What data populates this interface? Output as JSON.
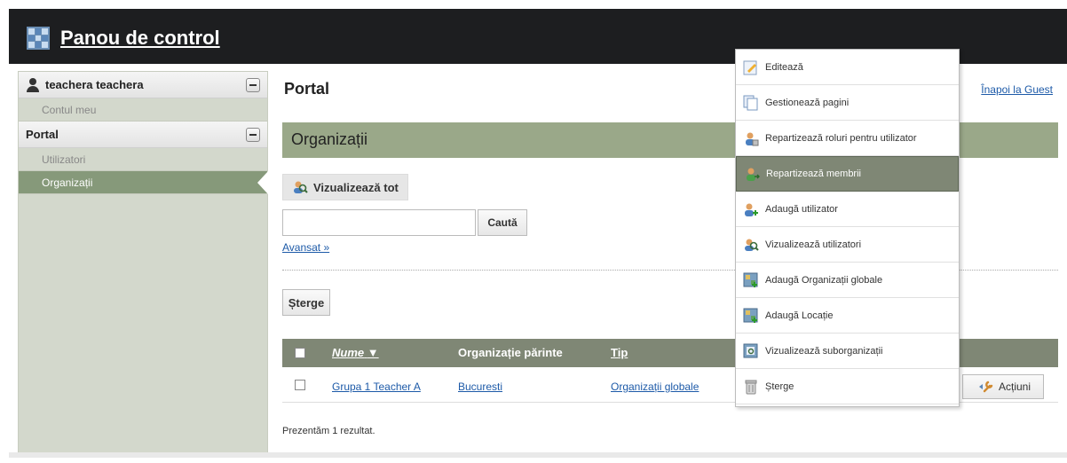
{
  "header": {
    "title": "Panou de control"
  },
  "sidebar": {
    "user_section": {
      "title": "teachera teachera",
      "items": [
        "Contul meu"
      ]
    },
    "portal_section": {
      "title": "Portal",
      "items": [
        "Utilizatori",
        "Organizații"
      ],
      "active": "Organizații"
    }
  },
  "main": {
    "title": "Portal",
    "back_link": "Înapoi la Guest",
    "section_title": "Organizații",
    "view_all": "Vizualizează tot",
    "search": {
      "value": "",
      "button": "Caută"
    },
    "advanced_link": "Avansat »",
    "delete_button": "Șterge",
    "table": {
      "headers": {
        "name": "Nume",
        "sort_indicator": "▼",
        "parent": "Organizație părinte",
        "type": "Tip"
      },
      "rows": [
        {
          "name": "Grupa 1 Teacher A",
          "parent": "Bucuresti",
          "type": "Organizații globale",
          "actions": "Acțiuni"
        }
      ]
    },
    "result_text": "Prezentăm 1 rezultat."
  },
  "menu": {
    "items": [
      {
        "label": "Editează",
        "icon": "edit-icon"
      },
      {
        "label": "Gestionează pagini",
        "icon": "pages-icon"
      },
      {
        "label": "Repartizează roluri pentru utilizator",
        "icon": "assign-roles-icon"
      },
      {
        "label": "Repartizează membrii",
        "icon": "assign-members-icon",
        "highlighted": true
      },
      {
        "label": "Adaugă utilizator",
        "icon": "add-user-icon"
      },
      {
        "label": "Vizualizează utilizatori",
        "icon": "view-users-icon"
      },
      {
        "label": "Adaugă Organizații globale",
        "icon": "add-organization-icon"
      },
      {
        "label": "Adaugă Locație",
        "icon": "add-location-icon"
      },
      {
        "label": "Vizualizează suborganizații",
        "icon": "view-suborganizations-icon"
      },
      {
        "label": "Șterge",
        "icon": "delete-icon"
      }
    ]
  }
}
